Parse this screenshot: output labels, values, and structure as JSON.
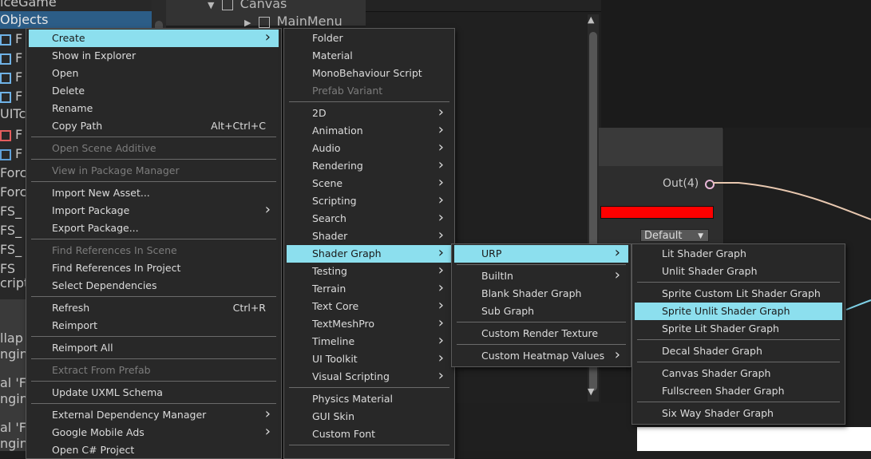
{
  "project_panel": {
    "rows": [
      {
        "text": "iceGame",
        "icon": "",
        "selected": false
      },
      {
        "text": "Objects",
        "icon": "",
        "selected": true
      },
      {
        "text": "F",
        "icon": "prefab-icon",
        "selected": false
      },
      {
        "text": "F",
        "icon": "prefab-icon",
        "selected": false
      },
      {
        "text": "F",
        "icon": "prefab-icon",
        "selected": false
      },
      {
        "text": "F",
        "icon": "prefab-variant-icon",
        "selected": false
      },
      {
        "text": "UITc",
        "icon": "",
        "selected": false
      },
      {
        "text": "F",
        "icon": "code-file-icon",
        "selected": false
      },
      {
        "text": "F",
        "icon": "image-file-icon",
        "selected": false
      },
      {
        "text": "Forc",
        "icon": "",
        "selected": false
      },
      {
        "text": "Forc",
        "icon": "",
        "selected": false
      },
      {
        "text": "FS_",
        "icon": "",
        "selected": false
      },
      {
        "text": "FS_",
        "icon": "",
        "selected": false
      },
      {
        "text": "FS_",
        "icon": "",
        "selected": false
      },
      {
        "text": "FS",
        "icon": "",
        "selected": false
      },
      {
        "text": "cript",
        "icon": "",
        "selected": false
      }
    ],
    "lower_rows": [
      "llap",
      "ngin",
      "al 'F",
      "ngin",
      "al 'F",
      "ngin"
    ]
  },
  "hierarchy": {
    "canvas_label": "Canvas",
    "mainmenu_label": "MainMenu"
  },
  "graph_node": {
    "out_label": "Out(4)",
    "dropdown_value": "Default"
  },
  "menu_main": {
    "items": [
      {
        "label": "Create",
        "shortcut": "",
        "submenu": true,
        "disabled": false,
        "highlighted": true
      },
      {
        "label": "Show in Explorer",
        "shortcut": "",
        "submenu": false,
        "disabled": false,
        "highlighted": false
      },
      {
        "label": "Open",
        "shortcut": "",
        "submenu": false,
        "disabled": false,
        "highlighted": false
      },
      {
        "label": "Delete",
        "shortcut": "",
        "submenu": false,
        "disabled": false,
        "highlighted": false
      },
      {
        "label": "Rename",
        "shortcut": "",
        "submenu": false,
        "disabled": false,
        "highlighted": false
      },
      {
        "label": "Copy Path",
        "shortcut": "Alt+Ctrl+C",
        "submenu": false,
        "disabled": false,
        "highlighted": false
      },
      {
        "label": "Open Scene Additive",
        "shortcut": "",
        "submenu": false,
        "disabled": true,
        "highlighted": false
      },
      {
        "label": "View in Package Manager",
        "shortcut": "",
        "submenu": false,
        "disabled": true,
        "highlighted": false
      },
      {
        "label": "Import New Asset...",
        "shortcut": "",
        "submenu": false,
        "disabled": false,
        "highlighted": false
      },
      {
        "label": "Import Package",
        "shortcut": "",
        "submenu": true,
        "disabled": false,
        "highlighted": false
      },
      {
        "label": "Export Package...",
        "shortcut": "",
        "submenu": false,
        "disabled": false,
        "highlighted": false
      },
      {
        "label": "Find References In Scene",
        "shortcut": "",
        "submenu": false,
        "disabled": true,
        "highlighted": false
      },
      {
        "label": "Find References In Project",
        "shortcut": "",
        "submenu": false,
        "disabled": false,
        "highlighted": false
      },
      {
        "label": "Select Dependencies",
        "shortcut": "",
        "submenu": false,
        "disabled": false,
        "highlighted": false
      },
      {
        "label": "Refresh",
        "shortcut": "Ctrl+R",
        "submenu": false,
        "disabled": false,
        "highlighted": false
      },
      {
        "label": "Reimport",
        "shortcut": "",
        "submenu": false,
        "disabled": false,
        "highlighted": false
      },
      {
        "label": "Reimport All",
        "shortcut": "",
        "submenu": false,
        "disabled": false,
        "highlighted": false
      },
      {
        "label": "Extract From Prefab",
        "shortcut": "",
        "submenu": false,
        "disabled": true,
        "highlighted": false
      },
      {
        "label": "Update UXML Schema",
        "shortcut": "",
        "submenu": false,
        "disabled": false,
        "highlighted": false
      },
      {
        "label": "External Dependency Manager",
        "shortcut": "",
        "submenu": true,
        "disabled": false,
        "highlighted": false
      },
      {
        "label": "Google Mobile Ads",
        "shortcut": "",
        "submenu": true,
        "disabled": false,
        "highlighted": false
      },
      {
        "label": "Open C# Project",
        "shortcut": "",
        "submenu": false,
        "disabled": false,
        "highlighted": false
      }
    ]
  },
  "menu_create": {
    "items": [
      {
        "label": "Folder",
        "submenu": false,
        "disabled": false,
        "highlighted": false
      },
      {
        "label": "Material",
        "submenu": false,
        "disabled": false,
        "highlighted": false
      },
      {
        "label": "MonoBehaviour Script",
        "submenu": false,
        "disabled": false,
        "highlighted": false
      },
      {
        "label": "Prefab Variant",
        "submenu": false,
        "disabled": true,
        "highlighted": false
      },
      {
        "label": "2D",
        "submenu": true,
        "disabled": false,
        "highlighted": false
      },
      {
        "label": "Animation",
        "submenu": true,
        "disabled": false,
        "highlighted": false
      },
      {
        "label": "Audio",
        "submenu": true,
        "disabled": false,
        "highlighted": false
      },
      {
        "label": "Rendering",
        "submenu": true,
        "disabled": false,
        "highlighted": false
      },
      {
        "label": "Scene",
        "submenu": true,
        "disabled": false,
        "highlighted": false
      },
      {
        "label": "Scripting",
        "submenu": true,
        "disabled": false,
        "highlighted": false
      },
      {
        "label": "Search",
        "submenu": true,
        "disabled": false,
        "highlighted": false
      },
      {
        "label": "Shader",
        "submenu": true,
        "disabled": false,
        "highlighted": false
      },
      {
        "label": "Shader Graph",
        "submenu": true,
        "disabled": false,
        "highlighted": true
      },
      {
        "label": "Testing",
        "submenu": true,
        "disabled": false,
        "highlighted": false
      },
      {
        "label": "Terrain",
        "submenu": true,
        "disabled": false,
        "highlighted": false
      },
      {
        "label": "Text Core",
        "submenu": true,
        "disabled": false,
        "highlighted": false
      },
      {
        "label": "TextMeshPro",
        "submenu": true,
        "disabled": false,
        "highlighted": false
      },
      {
        "label": "Timeline",
        "submenu": true,
        "disabled": false,
        "highlighted": false
      },
      {
        "label": "UI Toolkit",
        "submenu": true,
        "disabled": false,
        "highlighted": false
      },
      {
        "label": "Visual Scripting",
        "submenu": true,
        "disabled": false,
        "highlighted": false
      },
      {
        "label": "Physics Material",
        "submenu": false,
        "disabled": false,
        "highlighted": false
      },
      {
        "label": "GUI Skin",
        "submenu": false,
        "disabled": false,
        "highlighted": false
      },
      {
        "label": "Custom Font",
        "submenu": false,
        "disabled": false,
        "highlighted": false
      }
    ]
  },
  "menu_shader_graph": {
    "items": [
      {
        "label": "URP",
        "submenu": true,
        "disabled": false,
        "highlighted": true
      },
      {
        "label": "BuiltIn",
        "submenu": true,
        "disabled": false,
        "highlighted": false
      },
      {
        "label": "Blank Shader Graph",
        "submenu": false,
        "disabled": false,
        "highlighted": false
      },
      {
        "label": "Sub Graph",
        "submenu": false,
        "disabled": false,
        "highlighted": false
      },
      {
        "label": "Custom Render Texture",
        "submenu": false,
        "disabled": false,
        "highlighted": false
      },
      {
        "label": "Custom Heatmap Values",
        "submenu": true,
        "disabled": false,
        "highlighted": false
      }
    ]
  },
  "menu_urp": {
    "items": [
      {
        "label": "Lit Shader Graph",
        "submenu": false,
        "disabled": false,
        "highlighted": false
      },
      {
        "label": "Unlit Shader Graph",
        "submenu": false,
        "disabled": false,
        "highlighted": false
      },
      {
        "label": "Sprite Custom Lit Shader Graph",
        "submenu": false,
        "disabled": false,
        "highlighted": false
      },
      {
        "label": "Sprite Unlit Shader Graph",
        "submenu": false,
        "disabled": false,
        "highlighted": true
      },
      {
        "label": "Sprite Lit Shader Graph",
        "submenu": false,
        "disabled": false,
        "highlighted": false
      },
      {
        "label": "Decal Shader Graph",
        "submenu": false,
        "disabled": false,
        "highlighted": false
      },
      {
        "label": "Canvas Shader Graph",
        "submenu": false,
        "disabled": false,
        "highlighted": false
      },
      {
        "label": "Fullscreen Shader Graph",
        "submenu": false,
        "disabled": false,
        "highlighted": false
      },
      {
        "label": "Six Way Shader Graph",
        "submenu": false,
        "disabled": false,
        "highlighted": false
      }
    ]
  },
  "colors": {
    "highlight": "#8cdfee",
    "menu_bg": "#282828",
    "selection_blue": "#2c5d87",
    "node_color_swatch": "#ff0000"
  }
}
